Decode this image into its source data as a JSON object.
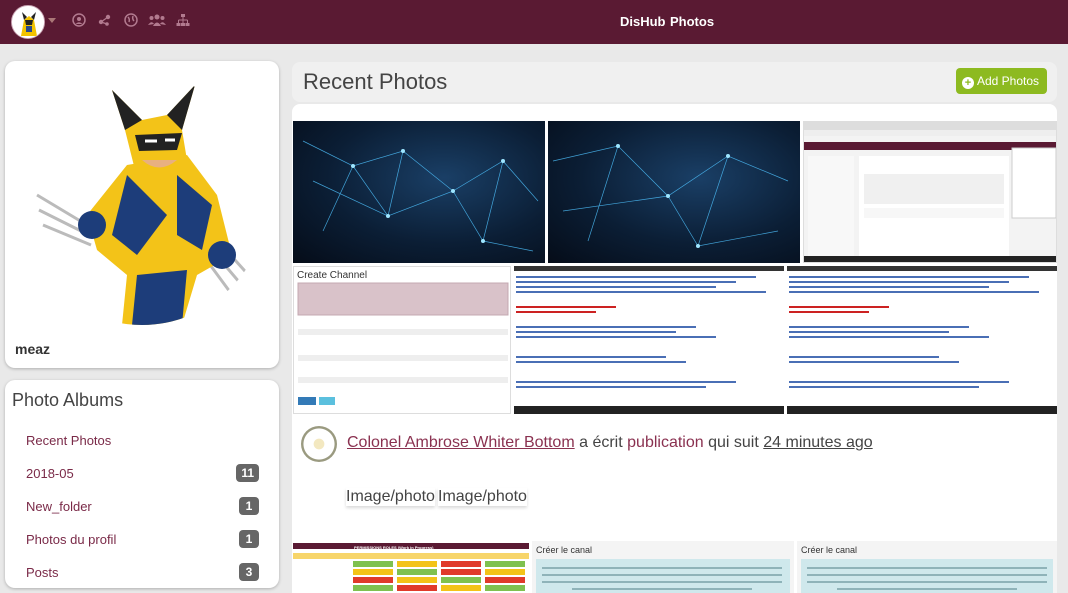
{
  "nav": {
    "brand": "DisHub",
    "section": "Photos",
    "icons": [
      "user-circle-icon",
      "network-icon",
      "globe-icon",
      "group-icon",
      "sitemap-icon"
    ]
  },
  "profile": {
    "name": "meaz"
  },
  "albums": {
    "title": "Photo Albums",
    "items": [
      {
        "label": "Recent Photos",
        "count": ""
      },
      {
        "label": "2018-05",
        "count": "11"
      },
      {
        "label": "New_folder",
        "count": "1"
      },
      {
        "label": "Photos du profil",
        "count": "1"
      },
      {
        "label": "Posts",
        "count": "3"
      }
    ]
  },
  "main": {
    "title": "Recent Photos",
    "add_button": "Add Photos",
    "activity": {
      "author": "Colonel Ambrose Whiter Bottom",
      "verb": "a écrit",
      "object": "publication",
      "suffix": "qui suit",
      "time": "24 minutes ago"
    },
    "captions": [
      "Image/photo",
      "Image/photo"
    ],
    "thumbs": {
      "create_channel_title": "Create Channel",
      "creer_canal_1": "Créer le canal",
      "creer_canal_2": "Créer le canal",
      "permissions_title": "PERMISSIONS ROLES (Work in Progress)"
    }
  },
  "colors": {
    "navbar": "#5a1a33",
    "accent_link": "#8a3150",
    "add_button": "#8dba20",
    "badge": "#666666"
  }
}
